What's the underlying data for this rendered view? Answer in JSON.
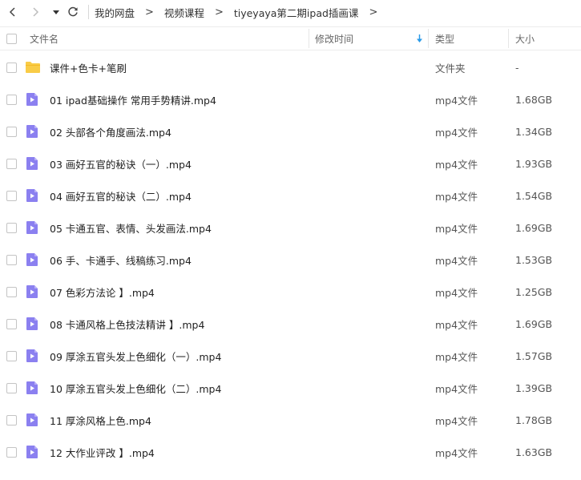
{
  "toolbar": {
    "back_icon": "chevron-left-icon",
    "forward_icon": "chevron-right-icon",
    "history_icon": "caret-down-icon",
    "refresh_icon": "refresh-icon",
    "breadcrumb": [
      "我的网盘",
      "视频课程",
      "tiyeyaya第二期ipad插画课"
    ],
    "separator": ">"
  },
  "header": {
    "name": "文件名",
    "modified": "修改时间",
    "type": "类型",
    "size": "大小",
    "sort_icon": "sort-arrow-down-icon",
    "accent": "#2a9be8"
  },
  "files": [
    {
      "name": "课件+色卡+笔刷",
      "type": "文件夹",
      "size": "-",
      "icon": "folder-icon"
    },
    {
      "name": "01 ipad基础操作 常用手势精讲.mp4",
      "type": "mp4文件",
      "size": "1.68GB",
      "icon": "video-file-icon"
    },
    {
      "name": "02 头部各个角度画法.mp4",
      "type": "mp4文件",
      "size": "1.34GB",
      "icon": "video-file-icon"
    },
    {
      "name": "03 画好五官的秘诀（一）.mp4",
      "type": "mp4文件",
      "size": "1.93GB",
      "icon": "video-file-icon"
    },
    {
      "name": "04 画好五官的秘诀（二）.mp4",
      "type": "mp4文件",
      "size": "1.54GB",
      "icon": "video-file-icon"
    },
    {
      "name": "05 卡通五官、表情、头发画法.mp4",
      "type": "mp4文件",
      "size": "1.69GB",
      "icon": "video-file-icon"
    },
    {
      "name": "06 手、卡通手、线稿练习.mp4",
      "type": "mp4文件",
      "size": "1.53GB",
      "icon": "video-file-icon"
    },
    {
      "name": "07 色彩方法论 】.mp4",
      "type": "mp4文件",
      "size": "1.25GB",
      "icon": "video-file-icon"
    },
    {
      "name": "08 卡通风格上色技法精讲 】.mp4",
      "type": "mp4文件",
      "size": "1.69GB",
      "icon": "video-file-icon"
    },
    {
      "name": "09 厚涂五官头发上色细化（一）.mp4",
      "type": "mp4文件",
      "size": "1.57GB",
      "icon": "video-file-icon"
    },
    {
      "name": "10 厚涂五官头发上色细化（二）.mp4",
      "type": "mp4文件",
      "size": "1.39GB",
      "icon": "video-file-icon"
    },
    {
      "name": "11 厚涂风格上色.mp4",
      "type": "mp4文件",
      "size": "1.78GB",
      "icon": "video-file-icon"
    },
    {
      "name": "12 大作业评改 】.mp4",
      "type": "mp4文件",
      "size": "1.63GB",
      "icon": "video-file-icon"
    }
  ],
  "colors": {
    "folder": "#f9cc47",
    "video_icon": "#8b80f0",
    "video_icon_fold": "#b8b0f7"
  }
}
